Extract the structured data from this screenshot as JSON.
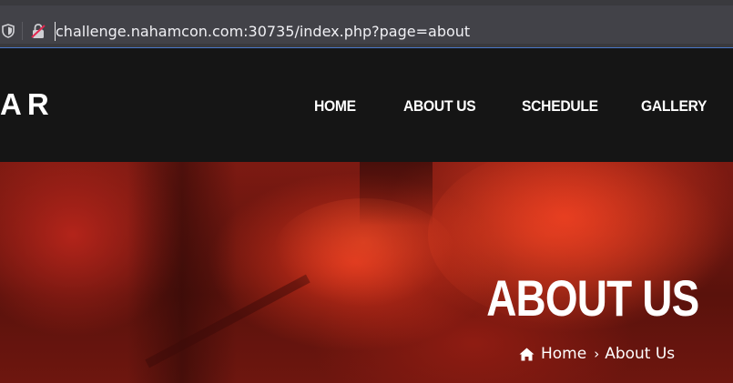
{
  "browser": {
    "url": "challenge.nahamcon.com:30735/index.php?page=about"
  },
  "header": {
    "logo_text": "AR",
    "nav": [
      "HOME",
      "ABOUT US",
      "SCHEDULE",
      "GALLERY"
    ]
  },
  "hero": {
    "title": "ABOUT US",
    "breadcrumb": {
      "home": "Home",
      "separator": "›",
      "current": "About Us"
    }
  },
  "colors": {
    "header_bg": "#151515",
    "hero_accent": "#d8311b",
    "url_bar_bg": "#424248"
  }
}
